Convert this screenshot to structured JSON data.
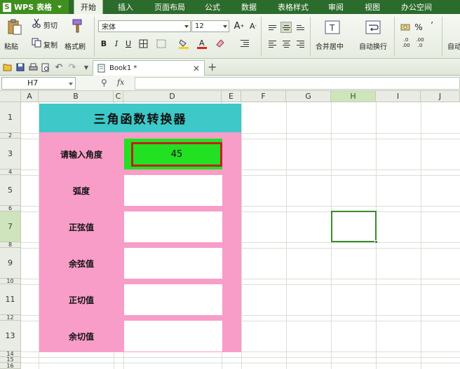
{
  "app": {
    "name": "WPS 表格"
  },
  "menu_tabs": [
    {
      "label": "开始",
      "active": true
    },
    {
      "label": "插入"
    },
    {
      "label": "页面布局"
    },
    {
      "label": "公式"
    },
    {
      "label": "数据"
    },
    {
      "label": "表格样式"
    },
    {
      "label": "审阅"
    },
    {
      "label": "视图"
    },
    {
      "label": "办公空间"
    }
  ],
  "ribbon": {
    "paste": "粘贴",
    "cut": "剪切",
    "copy": "复制",
    "format_painter": "格式刷",
    "font_name": "宋体",
    "font_size": "12",
    "merge_center": "合并居中",
    "wrap_text": "自动换行",
    "percent": "%",
    "inc_decimal": ".0 .00",
    "dec_decimal": ".00 .0",
    "auto_sum": "自动"
  },
  "document": {
    "tab_title": "Book1 *"
  },
  "formula_bar": {
    "name_box": "H7",
    "fx": "fx",
    "value": ""
  },
  "columns": [
    "A",
    "B",
    "C",
    "D",
    "E",
    "F",
    "G",
    "H",
    "I",
    "J"
  ],
  "rows": [
    "1",
    "2",
    "3",
    "4",
    "5",
    "6",
    "7",
    "8",
    "9",
    "10",
    "11",
    "12",
    "13",
    "14",
    "15",
    "16"
  ],
  "sheet": {
    "title": "三角函数转换器",
    "input_label": "请输入角度",
    "input_value": "45",
    "outputs": [
      {
        "label": "弧度",
        "value": ""
      },
      {
        "label": "正弦值",
        "value": ""
      },
      {
        "label": "余弦值",
        "value": ""
      },
      {
        "label": "正切值",
        "value": ""
      },
      {
        "label": "余切值",
        "value": ""
      }
    ]
  },
  "colors": {
    "title_band": "#3ec8c8",
    "panel": "#f79dc8",
    "input_fill": "#22e022",
    "input_border": "#c02020",
    "menu_bar": "#2b6b2b"
  }
}
